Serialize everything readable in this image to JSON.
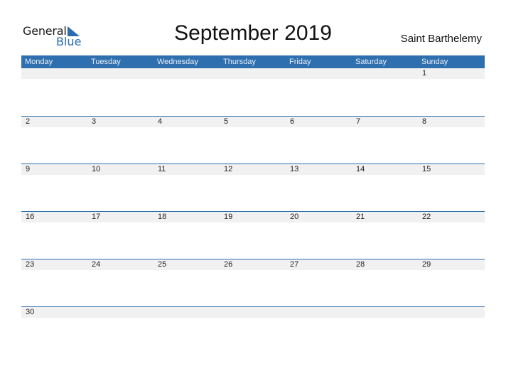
{
  "logo": {
    "line1": "General",
    "line2": "Blue"
  },
  "title": "September 2019",
  "region": "Saint Barthelemy",
  "weekdays": [
    "Monday",
    "Tuesday",
    "Wednesday",
    "Thursday",
    "Friday",
    "Saturday",
    "Sunday"
  ],
  "weeks": [
    [
      "",
      "",
      "",
      "",
      "",
      "",
      "1"
    ],
    [
      "2",
      "3",
      "4",
      "5",
      "6",
      "7",
      "8"
    ],
    [
      "9",
      "10",
      "11",
      "12",
      "13",
      "14",
      "15"
    ],
    [
      "16",
      "17",
      "18",
      "19",
      "20",
      "21",
      "22"
    ],
    [
      "23",
      "24",
      "25",
      "26",
      "27",
      "28",
      "29"
    ],
    [
      "30",
      "",
      "",
      "",
      "",
      "",
      ""
    ]
  ],
  "colors": {
    "accent": "#2e6faf",
    "band": "#f1f1f1"
  }
}
